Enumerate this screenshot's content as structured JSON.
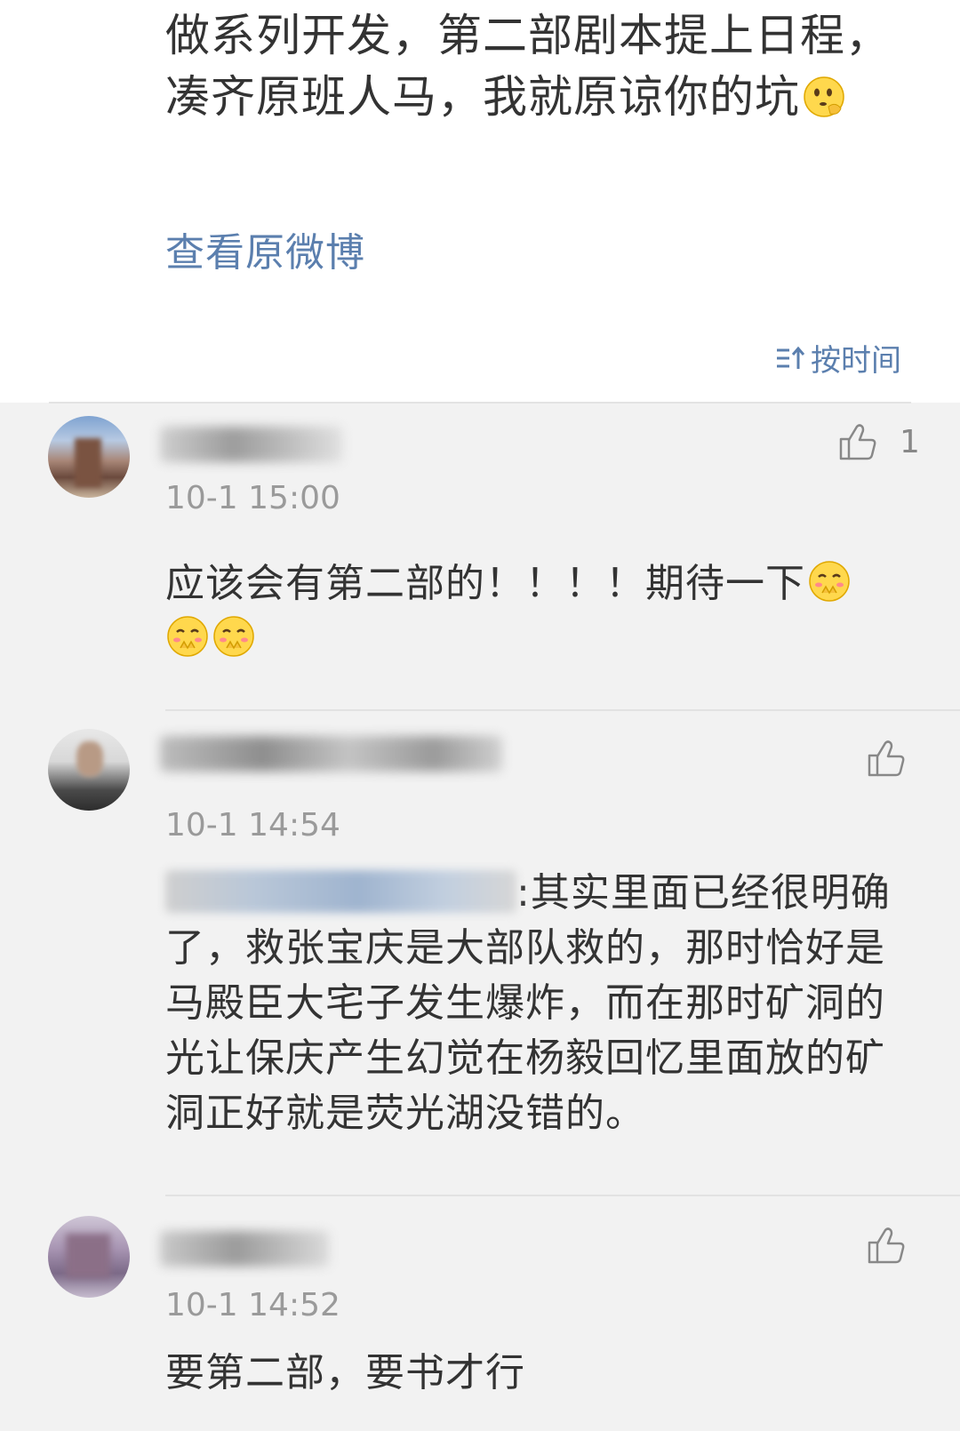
{
  "post": {
    "text": "做系列开发，第二部剧本提上日程，凑齐原班人马，我就原谅你的坑",
    "emoji": "thinking-face-emoji",
    "view_original": "查看原微博",
    "sort_label": "按时间"
  },
  "comments": [
    {
      "timestamp": "10-1 15:00",
      "text": "应该会有第二部的！！！！期待一下",
      "emojis": [
        "blushing-face-emoji",
        "blushing-face-emoji",
        "blushing-face-emoji"
      ],
      "likes": "1"
    },
    {
      "timestamp": "10-1 14:54",
      "text": ":其实里面已经很明确了，救张宝庆是大部队救的，那时恰好是马殿臣大宅子发生爆炸，而在那时矿洞的光让保庆产生幻觉在杨毅回忆里面放的矿洞正好就是荧光湖没错的。",
      "likes": ""
    },
    {
      "timestamp": "10-1 14:52",
      "text": "要第二部，要书才行",
      "likes": ""
    }
  ],
  "colors": {
    "link": "#5b7fae",
    "timestamp": "#9a9a9a",
    "background": "#f2f2f2"
  }
}
